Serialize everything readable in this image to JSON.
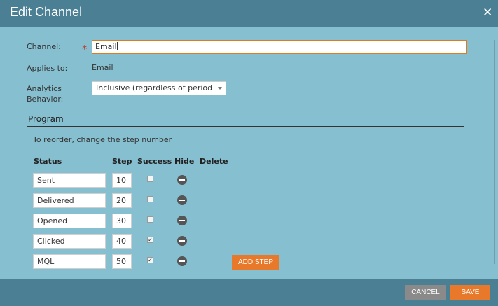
{
  "dialog": {
    "title": "Edit Channel",
    "close_icon": "close-icon"
  },
  "form": {
    "channel_label": "Channel:",
    "channel_value": "Email",
    "applies_label": "Applies to:",
    "applies_value": "Email",
    "analytics_label_line1": "Analytics",
    "analytics_label_line2": "Behavior:",
    "analytics_value": "Inclusive (regardless of period c"
  },
  "program": {
    "section_title": "Program",
    "hint": "To reorder, change the step number",
    "columns": {
      "status": "Status",
      "step": "Step",
      "success": "Success",
      "hide": "Hide",
      "delete": "Delete"
    },
    "rows": [
      {
        "status": "Sent",
        "step": "10",
        "success": false,
        "success_mark": ""
      },
      {
        "status": "Delivered",
        "step": "20",
        "success": false,
        "success_mark": ""
      },
      {
        "status": "Opened",
        "step": "30",
        "success": false,
        "success_mark": ""
      },
      {
        "status": "Clicked",
        "step": "40",
        "success": true,
        "success_mark": "✓"
      },
      {
        "status": "MQL",
        "step": "50",
        "success": true,
        "success_mark": "✓"
      }
    ],
    "add_step_label": "ADD STEP"
  },
  "footer": {
    "cancel_label": "CANCEL",
    "save_label": "SAVE"
  },
  "colors": {
    "header_footer": "#4a7f94",
    "body_bg": "#86bfcf",
    "accent_orange": "#e8792b",
    "cancel_gray": "#8a8a8a"
  }
}
